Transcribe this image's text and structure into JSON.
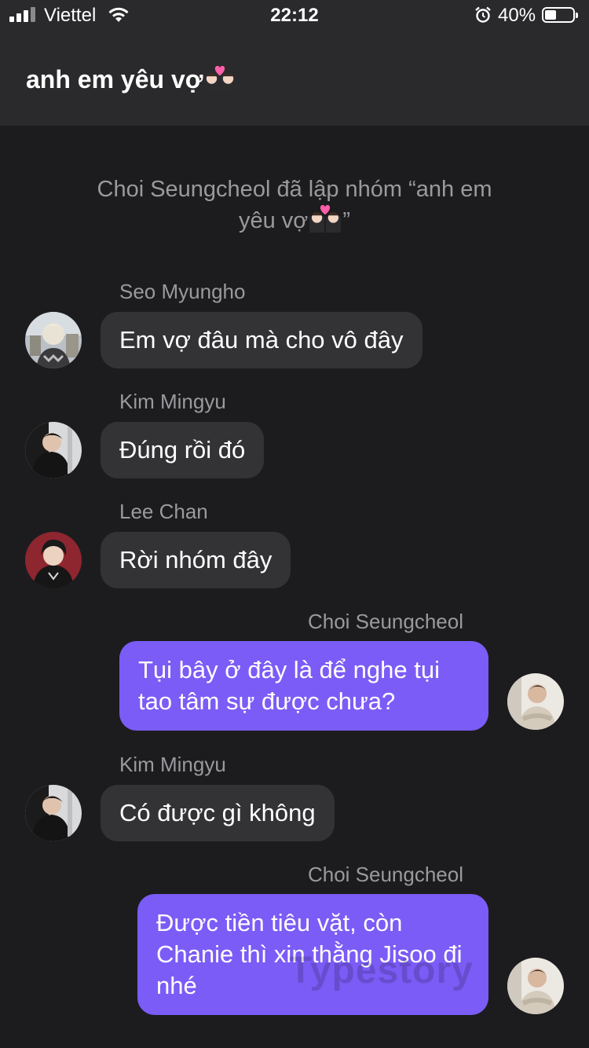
{
  "status_bar": {
    "carrier": "Viettel",
    "time": "22:12",
    "battery_percent": "40%",
    "battery_level": 0.4,
    "icons": [
      "signal-icon",
      "wifi-icon",
      "alarm-icon",
      "battery-icon"
    ]
  },
  "chat": {
    "title": "anh em yêu vợ",
    "title_emoji": "couple-with-heart",
    "system_message": "Choi Seungcheol đã lập nhóm “anh em yêu vợ",
    "system_message_end": "”"
  },
  "messages": [
    {
      "sender": "Seo Myungho",
      "text": "Em vợ đâu mà cho vô đây",
      "direction": "incoming"
    },
    {
      "sender": "Kim Mingyu",
      "text": "Đúng rồi đó",
      "direction": "incoming"
    },
    {
      "sender": "Lee Chan",
      "text": "Rời nhóm đây",
      "direction": "incoming"
    },
    {
      "sender": "Choi Seungcheol",
      "text": "Tụi bây ở đây là để nghe tụi tao tâm sự được chưa?",
      "direction": "outgoing"
    },
    {
      "sender": "Kim Mingyu",
      "text": "Có được gì không",
      "direction": "incoming"
    },
    {
      "sender": "Choi Seungcheol",
      "text": "Được tiền tiêu vặt, còn Chanie thì xin thằng Jisoo đi nhé",
      "direction": "outgoing"
    }
  ],
  "watermark": "Typestory",
  "colors": {
    "background": "#1c1c1e",
    "header": "#2a2a2c",
    "incoming_bubble": "#333336",
    "outgoing_bubble": "#7b5cf6",
    "secondary_text": "#9a9a9e"
  }
}
